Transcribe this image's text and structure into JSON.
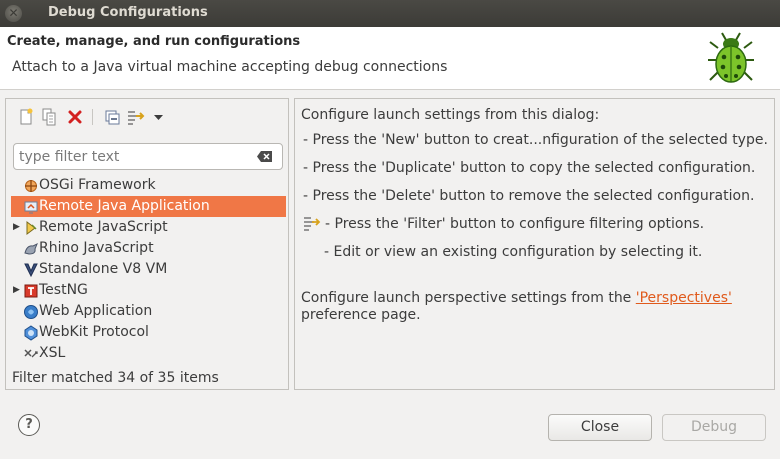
{
  "window": {
    "title": "Debug Configurations"
  },
  "header": {
    "title": "Create, manage, and run configurations",
    "description": "Attach to a Java virtual machine accepting debug connections",
    "icon": "bug-icon"
  },
  "filter": {
    "placeholder": "type filter text",
    "value": ""
  },
  "tree": [
    {
      "label": "OSGi Framework",
      "icon": "osgi-icon",
      "expandable": false,
      "selected": false
    },
    {
      "label": "Remote Java Application",
      "icon": "remote-java-icon",
      "expandable": false,
      "selected": true
    },
    {
      "label": "Remote JavaScript",
      "icon": "remote-javascript-icon",
      "expandable": true,
      "selected": false
    },
    {
      "label": "Rhino JavaScript",
      "icon": "rhino-icon",
      "expandable": false,
      "selected": false
    },
    {
      "label": "Standalone V8 VM",
      "icon": "v8-icon",
      "expandable": false,
      "selected": false
    },
    {
      "label": "TestNG",
      "icon": "testng-icon",
      "expandable": true,
      "selected": false
    },
    {
      "label": "Web Application",
      "icon": "web-application-icon",
      "expandable": false,
      "selected": false
    },
    {
      "label": "WebKit Protocol",
      "icon": "webkit-icon",
      "expandable": false,
      "selected": false
    },
    {
      "label": "XSL",
      "icon": "xsl-icon",
      "expandable": false,
      "selected": false
    }
  ],
  "filter_status": "Filter matched 34 of 35 items",
  "info": {
    "intro": "Configure launch settings from this dialog:",
    "new_line": "- Press the 'New' button to creat...nfiguration of the selected type.",
    "duplicate_line": "- Press the 'Duplicate' button to copy the selected configuration.",
    "delete_line": "- Press the 'Delete' button to remove the selected configuration.",
    "filter_line": "- Press the 'Filter' button to configure filtering options.",
    "edit_line": "- Edit or view an existing configuration by selecting it.",
    "perspective_prefix": "Configure launch perspective settings from the",
    "perspective_link": "'Perspectives'",
    "perspective_suffix": "preference page."
  },
  "buttons": {
    "close": "Close",
    "debug": "Debug",
    "help": "?"
  },
  "colors": {
    "selection": "#f07746",
    "link": "#e05a1c"
  }
}
